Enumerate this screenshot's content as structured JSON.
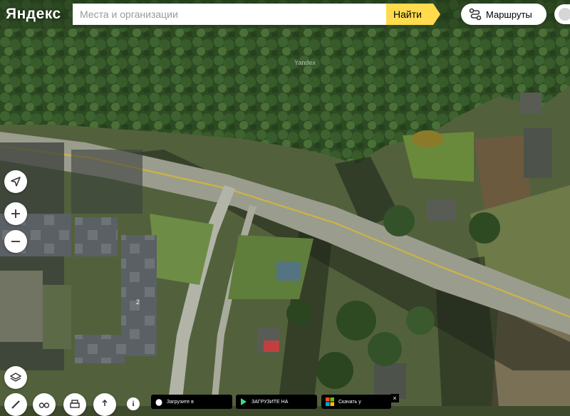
{
  "header": {
    "logo": "Яндекс",
    "search_placeholder": "Места и организации",
    "search_button": "Найти",
    "routes_button": "Маршруты"
  },
  "map": {
    "watermark": "Yandex",
    "building_number": "2"
  },
  "badges": {
    "appstore": "Загрузите в",
    "googleplay": "ЗАГРУЗИТЕ НА",
    "microsoft": "Скачать у"
  },
  "colors": {
    "accent": "#ffdb4d",
    "road_center_line": "#c9b24a"
  },
  "icons": [
    "locate-icon",
    "zoom-in-icon",
    "zoom-out-icon",
    "layers-icon",
    "ruler-icon",
    "binoculars-icon",
    "print-icon",
    "share-icon",
    "info-icon",
    "routes-icon"
  ]
}
